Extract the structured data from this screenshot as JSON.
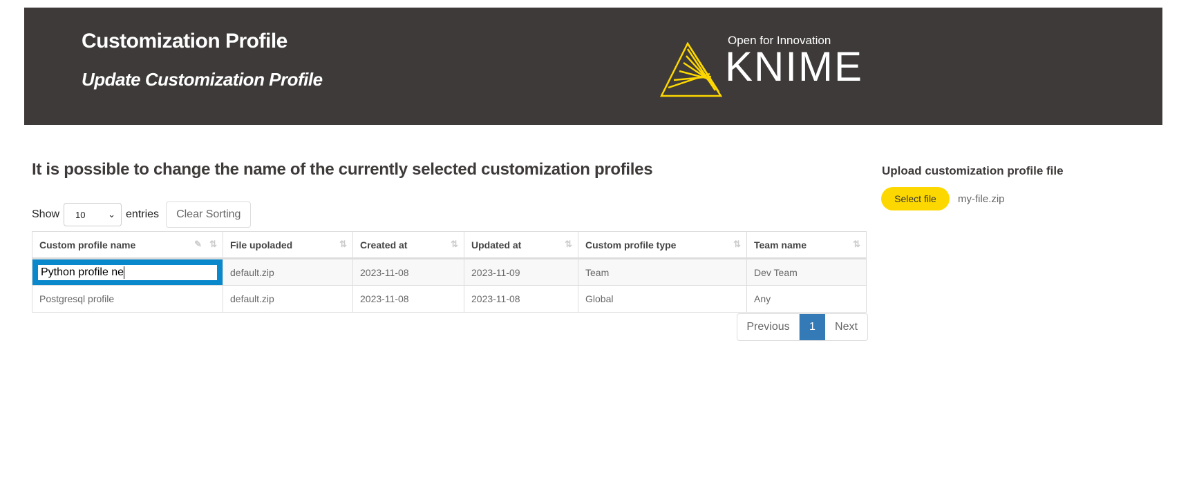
{
  "header": {
    "title": "Customization Profile",
    "subtitle": "Update Customization Profile",
    "logo_tagline": "Open for Innovation",
    "logo_text": "KNIME",
    "logo_color": "#fdd800",
    "background": "#3e3a39"
  },
  "main": {
    "heading": "It is possible to change the name of the currently selected customization profiles",
    "show_label": "Show",
    "entries_select": "10",
    "entries_label": "entries",
    "clear_sorting": "Clear Sorting",
    "columns": [
      "Custom profile name",
      "File upoladed",
      "Created at",
      "Updated at",
      "Custom profile type",
      "Team name"
    ],
    "rows": [
      {
        "name": "Python profile ne",
        "file": "default.zip",
        "created": "2023-11-08",
        "updated": "2023-11-09",
        "type": "Team",
        "team": "Dev Team"
      },
      {
        "name": "Postgresql profile",
        "file": "default.zip",
        "created": "2023-11-08",
        "updated": "2023-11-08",
        "type": "Global",
        "team": "Any"
      }
    ],
    "pagination": {
      "previous": "Previous",
      "current": "1",
      "next": "Next"
    }
  },
  "upload": {
    "title": "Upload customization profile file",
    "button": "Select file",
    "filename": "my-file.zip"
  }
}
